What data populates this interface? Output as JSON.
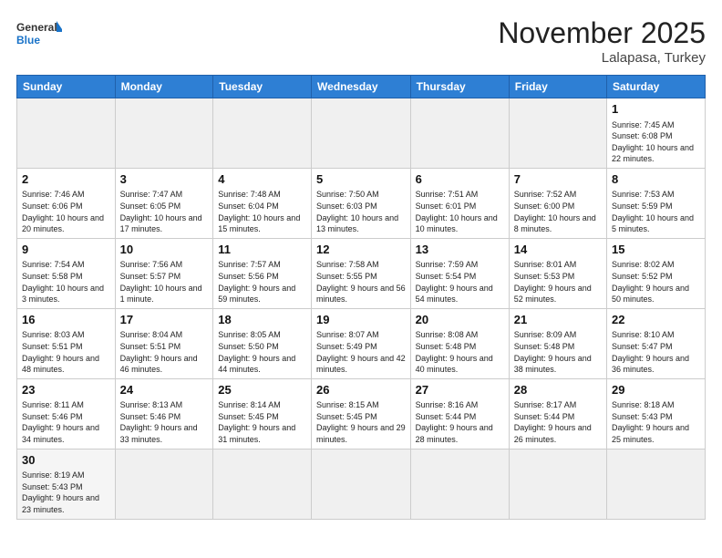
{
  "header": {
    "logo_general": "General",
    "logo_blue": "Blue",
    "month_title": "November 2025",
    "location": "Lalapasa, Turkey"
  },
  "days_of_week": [
    "Sunday",
    "Monday",
    "Tuesday",
    "Wednesday",
    "Thursday",
    "Friday",
    "Saturday"
  ],
  "weeks": [
    [
      {
        "day": "",
        "empty": true
      },
      {
        "day": "",
        "empty": true
      },
      {
        "day": "",
        "empty": true
      },
      {
        "day": "",
        "empty": true
      },
      {
        "day": "",
        "empty": true
      },
      {
        "day": "",
        "empty": true
      },
      {
        "day": "1",
        "sunrise": "7:45 AM",
        "sunset": "6:08 PM",
        "daylight": "10 hours and 22 minutes."
      }
    ],
    [
      {
        "day": "2",
        "sunrise": "7:46 AM",
        "sunset": "6:06 PM",
        "daylight": "10 hours and 20 minutes."
      },
      {
        "day": "3",
        "sunrise": "7:47 AM",
        "sunset": "6:05 PM",
        "daylight": "10 hours and 17 minutes."
      },
      {
        "day": "4",
        "sunrise": "7:48 AM",
        "sunset": "6:04 PM",
        "daylight": "10 hours and 15 minutes."
      },
      {
        "day": "5",
        "sunrise": "7:50 AM",
        "sunset": "6:03 PM",
        "daylight": "10 hours and 13 minutes."
      },
      {
        "day": "6",
        "sunrise": "7:51 AM",
        "sunset": "6:01 PM",
        "daylight": "10 hours and 10 minutes."
      },
      {
        "day": "7",
        "sunrise": "7:52 AM",
        "sunset": "6:00 PM",
        "daylight": "10 hours and 8 minutes."
      },
      {
        "day": "8",
        "sunrise": "7:53 AM",
        "sunset": "5:59 PM",
        "daylight": "10 hours and 5 minutes."
      }
    ],
    [
      {
        "day": "9",
        "sunrise": "7:54 AM",
        "sunset": "5:58 PM",
        "daylight": "10 hours and 3 minutes."
      },
      {
        "day": "10",
        "sunrise": "7:56 AM",
        "sunset": "5:57 PM",
        "daylight": "10 hours and 1 minute."
      },
      {
        "day": "11",
        "sunrise": "7:57 AM",
        "sunset": "5:56 PM",
        "daylight": "9 hours and 59 minutes."
      },
      {
        "day": "12",
        "sunrise": "7:58 AM",
        "sunset": "5:55 PM",
        "daylight": "9 hours and 56 minutes."
      },
      {
        "day": "13",
        "sunrise": "7:59 AM",
        "sunset": "5:54 PM",
        "daylight": "9 hours and 54 minutes."
      },
      {
        "day": "14",
        "sunrise": "8:01 AM",
        "sunset": "5:53 PM",
        "daylight": "9 hours and 52 minutes."
      },
      {
        "day": "15",
        "sunrise": "8:02 AM",
        "sunset": "5:52 PM",
        "daylight": "9 hours and 50 minutes."
      }
    ],
    [
      {
        "day": "16",
        "sunrise": "8:03 AM",
        "sunset": "5:51 PM",
        "daylight": "9 hours and 48 minutes."
      },
      {
        "day": "17",
        "sunrise": "8:04 AM",
        "sunset": "5:51 PM",
        "daylight": "9 hours and 46 minutes."
      },
      {
        "day": "18",
        "sunrise": "8:05 AM",
        "sunset": "5:50 PM",
        "daylight": "9 hours and 44 minutes."
      },
      {
        "day": "19",
        "sunrise": "8:07 AM",
        "sunset": "5:49 PM",
        "daylight": "9 hours and 42 minutes."
      },
      {
        "day": "20",
        "sunrise": "8:08 AM",
        "sunset": "5:48 PM",
        "daylight": "9 hours and 40 minutes."
      },
      {
        "day": "21",
        "sunrise": "8:09 AM",
        "sunset": "5:48 PM",
        "daylight": "9 hours and 38 minutes."
      },
      {
        "day": "22",
        "sunrise": "8:10 AM",
        "sunset": "5:47 PM",
        "daylight": "9 hours and 36 minutes."
      }
    ],
    [
      {
        "day": "23",
        "sunrise": "8:11 AM",
        "sunset": "5:46 PM",
        "daylight": "9 hours and 34 minutes."
      },
      {
        "day": "24",
        "sunrise": "8:13 AM",
        "sunset": "5:46 PM",
        "daylight": "9 hours and 33 minutes."
      },
      {
        "day": "25",
        "sunrise": "8:14 AM",
        "sunset": "5:45 PM",
        "daylight": "9 hours and 31 minutes."
      },
      {
        "day": "26",
        "sunrise": "8:15 AM",
        "sunset": "5:45 PM",
        "daylight": "9 hours and 29 minutes."
      },
      {
        "day": "27",
        "sunrise": "8:16 AM",
        "sunset": "5:44 PM",
        "daylight": "9 hours and 28 minutes."
      },
      {
        "day": "28",
        "sunrise": "8:17 AM",
        "sunset": "5:44 PM",
        "daylight": "9 hours and 26 minutes."
      },
      {
        "day": "29",
        "sunrise": "8:18 AM",
        "sunset": "5:43 PM",
        "daylight": "9 hours and 25 minutes."
      }
    ],
    [
      {
        "day": "30",
        "sunrise": "8:19 AM",
        "sunset": "5:43 PM",
        "daylight": "9 hours and 23 minutes."
      },
      {
        "day": "",
        "empty": true
      },
      {
        "day": "",
        "empty": true
      },
      {
        "day": "",
        "empty": true
      },
      {
        "day": "",
        "empty": true
      },
      {
        "day": "",
        "empty": true
      },
      {
        "day": "",
        "empty": true
      }
    ]
  ]
}
